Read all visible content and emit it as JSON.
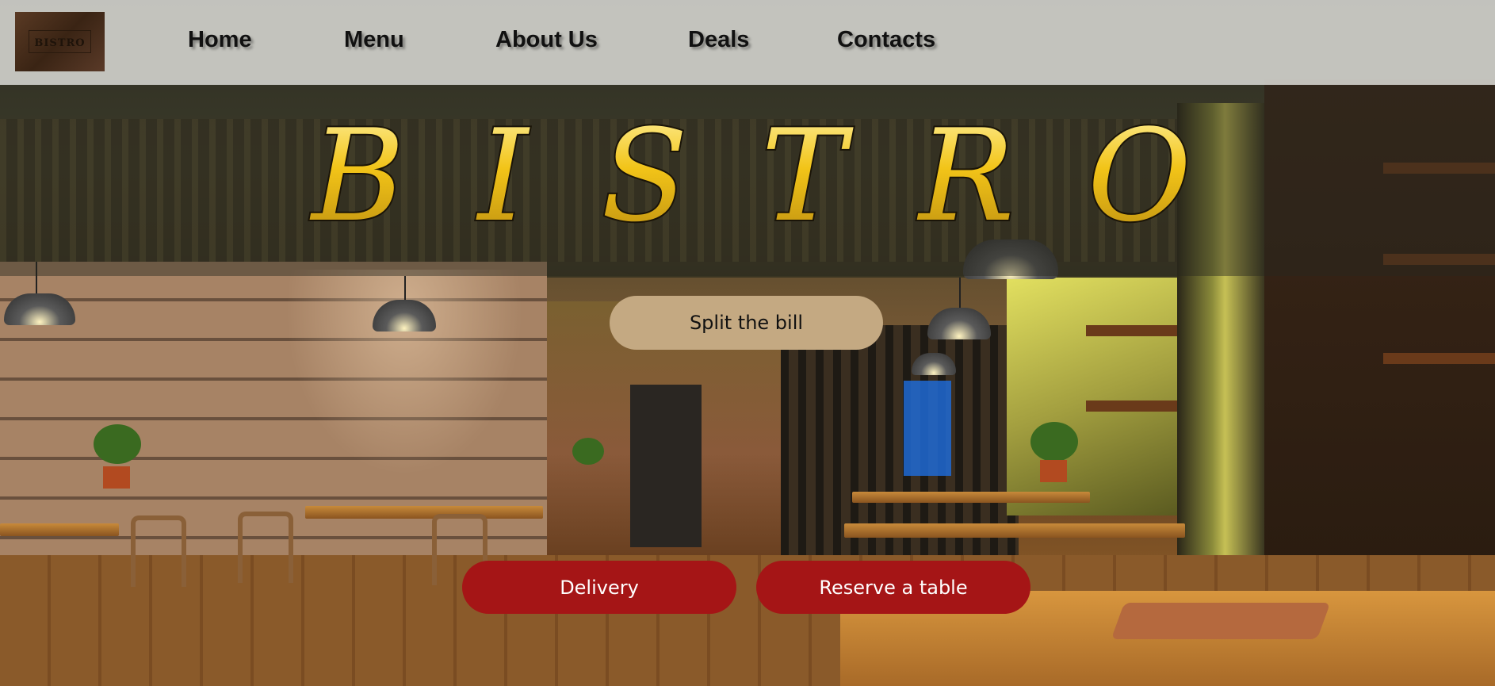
{
  "logo": {
    "text": "BISTRO"
  },
  "nav": [
    {
      "label": "Home"
    },
    {
      "label": "Menu"
    },
    {
      "label": "About Us"
    },
    {
      "label": "Deals"
    },
    {
      "label": "Contacts"
    }
  ],
  "hero": {
    "title": "BISTRO"
  },
  "buttons": {
    "split_bill": "Split the bill",
    "delivery": "Delivery",
    "reserve": "Reserve a table"
  },
  "colors": {
    "header_bg": "#cecec8",
    "title_gold": "#f2c418",
    "split_button": "#c4a982",
    "action_button": "#a51516"
  }
}
